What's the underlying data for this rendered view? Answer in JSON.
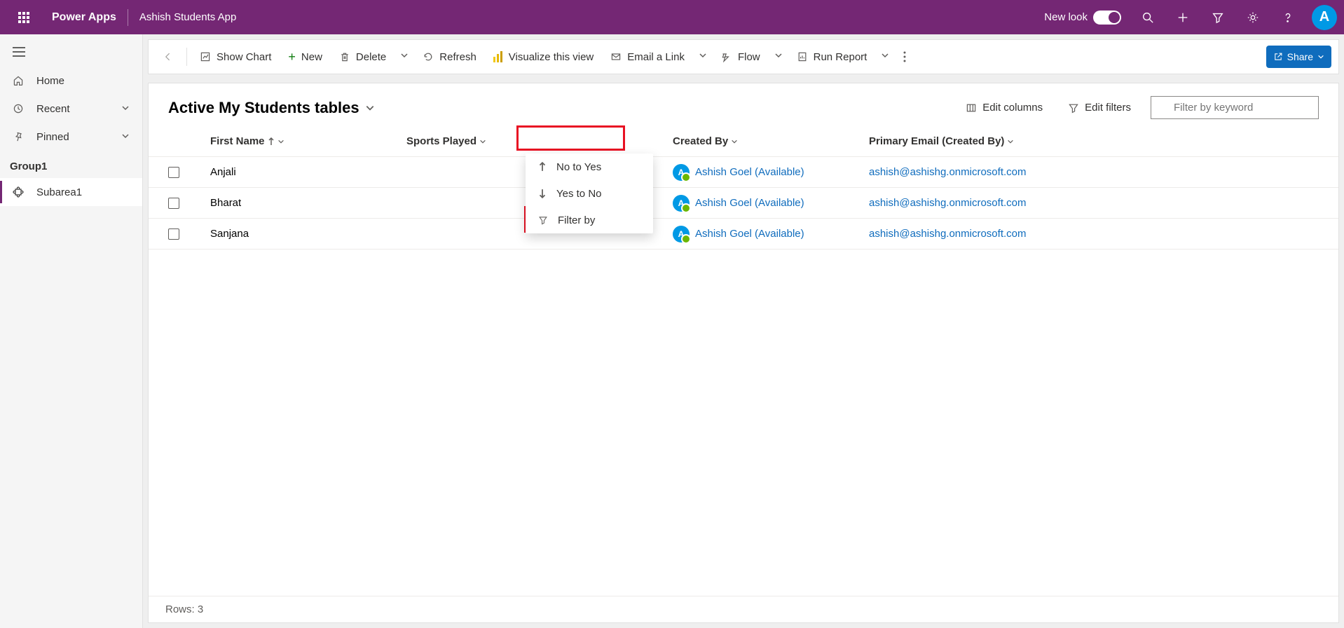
{
  "header": {
    "appTitle": "Power Apps",
    "appName": "Ashish Students App",
    "newLook": "New look",
    "avatarInitial": "A"
  },
  "sidebar": {
    "home": "Home",
    "recent": "Recent",
    "pinned": "Pinned",
    "group": "Group1",
    "subarea": "Subarea1"
  },
  "cmdbar": {
    "showChart": "Show Chart",
    "new": "New",
    "delete": "Delete",
    "refresh": "Refresh",
    "visualize": "Visualize this view",
    "emailLink": "Email a Link",
    "flow": "Flow",
    "runReport": "Run Report",
    "share": "Share"
  },
  "view": {
    "title": "Active My Students tables",
    "editColumns": "Edit columns",
    "editFilters": "Edit filters",
    "filterPlaceholder": "Filter by keyword"
  },
  "columns": {
    "firstName": "First Name",
    "sportsPlayed": "Sports Played",
    "createdBy": "Created By",
    "primaryEmail": "Primary Email (Created By)"
  },
  "dropdown": {
    "noToYes": "No to Yes",
    "yesToNo": "Yes to No",
    "filterBy": "Filter by"
  },
  "rows": [
    {
      "firstName": "Anjali",
      "createdBy": "Ashish Goel (Available)",
      "email": "ashish@ashishg.onmicrosoft.com"
    },
    {
      "firstName": "Bharat",
      "createdBy": "Ashish Goel (Available)",
      "email": "ashish@ashishg.onmicrosoft.com"
    },
    {
      "firstName": "Sanjana",
      "createdBy": "Ashish Goel (Available)",
      "email": "ashish@ashishg.onmicrosoft.com"
    }
  ],
  "footer": {
    "rowsLabel": "Rows: 3"
  }
}
